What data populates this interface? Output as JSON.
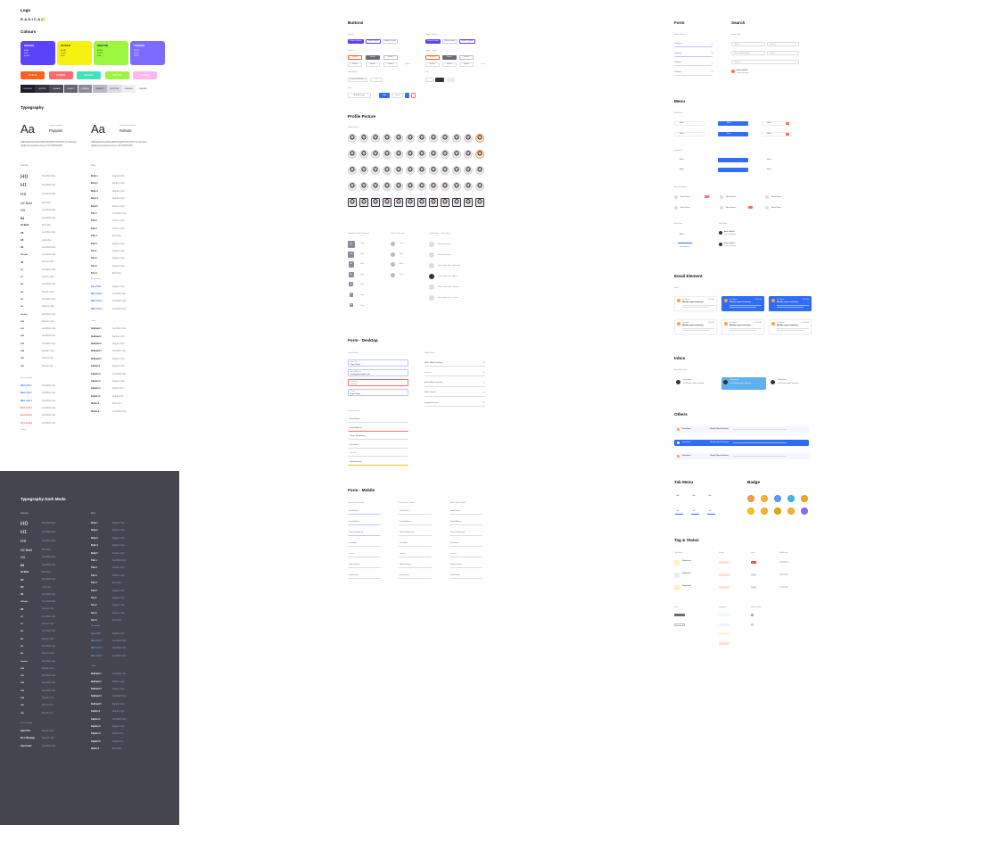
{
  "logo": {
    "heading": "Logo",
    "wordmark": "RADICAL"
  },
  "colours": {
    "heading": "Colours",
    "primary": [
      {
        "name": "#5943FE",
        "codes": [
          "R 89",
          "G 67",
          "B 254"
        ],
        "bg": "#5b43fb",
        "fg": "#ffffff"
      },
      {
        "name": "#F5F212",
        "codes": [
          "R 245",
          "G 242",
          "B 18"
        ],
        "bg": "#f5f212",
        "fg": "#1d1d2b"
      },
      {
        "name": "#9BF73D",
        "codes": [
          "R 155",
          "G 247",
          "B 61"
        ],
        "bg": "#9bf73d",
        "fg": "#1d1d2b"
      },
      {
        "name": "#7B6BFE",
        "codes": [
          "R 123",
          "G 107",
          "B 254"
        ],
        "bg": "#7b6bfe",
        "fg": "#ffffff"
      }
    ],
    "secondary": [
      {
        "name": "#FF5F1F",
        "bg": "#ff5f1f"
      },
      {
        "name": "#FF6B6B",
        "bg": "#ff6b6b"
      },
      {
        "name": "#41E2BA",
        "bg": "#41e2ba"
      },
      {
        "name": "#9BF73D",
        "bg": "#9bf73d"
      },
      {
        "name": "#FFB8EC",
        "bg": "#ffb8ec"
      }
    ],
    "greys": [
      {
        "name": "#1D1D2B",
        "bg": "#1d1d2b",
        "fg": "#ffffff"
      },
      {
        "name": "#32323F",
        "bg": "#32323f",
        "fg": "#ffffff"
      },
      {
        "name": "#4A4A58",
        "bg": "#4a4a58",
        "fg": "#ffffff"
      },
      {
        "name": "#646472",
        "bg": "#646472",
        "fg": "#ffffff"
      },
      {
        "name": "#8B8B99",
        "bg": "#8b8b99",
        "fg": "#ffffff"
      },
      {
        "name": "#B9B9C4",
        "bg": "#b9b9c4",
        "fg": "#1d1d2b"
      },
      {
        "name": "#DCDCE4",
        "bg": "#dcdce4",
        "fg": "#1d1d2b"
      },
      {
        "name": "#EFEFF4",
        "bg": "#efeff4",
        "fg": "#1d1d2b"
      },
      {
        "name": "#FFFFFF",
        "bg": "#ffffff",
        "fg": "#1d1d2b"
      }
    ]
  },
  "typography": {
    "heading": "Typography",
    "font1": {
      "sample": "Aa",
      "caption": "Primary Typeface",
      "name": "Poppins",
      "alphabet": "ABCDEFGHIJKLMNOPQRSTUVWXYZ abcdefghijklmnopqrstuvwxyz 0123456789"
    },
    "font2": {
      "sample": "Aa",
      "caption": "Secondary Typeface",
      "name": "Roboto",
      "alphabet": "ABCDEFGHIJKLMNOPQRSTUVWXYZ abcdefghijklmnopqrstuvwxyz 0123456789"
    },
    "left_col_title": "Heading",
    "right_col_title": "Body",
    "headings": [
      {
        "tag": "H0",
        "desc": "SemiBold 96px",
        "size": 6.4
      },
      {
        "tag": "H1",
        "desc": "SemiBold 64px",
        "size": 5.6
      },
      {
        "tag": "H2",
        "desc": "SemiBold 48px",
        "size": 4.8
      },
      {
        "tag": "H2 Bold",
        "desc": "Bold 48px",
        "size": 3.6
      },
      {
        "tag": "H3",
        "desc": "SemiBold 40px",
        "size": 3.8
      },
      {
        "tag": "H4",
        "desc": "SemiBold 32px",
        "size": 3.2
      },
      {
        "tag": "H4 Bold",
        "desc": "Bold 32px",
        "size": 2.4
      },
      {
        "tag": "H5",
        "desc": "SemiBold 24px",
        "size": 2.6
      },
      {
        "tag": "H5",
        "desc": "Light 24px",
        "size": 2.6
      },
      {
        "tag": "H6",
        "desc": "SemiBold 20px",
        "size": 2.4
      },
      {
        "tag": "H6 Italic",
        "desc": "SemiBold 20px",
        "size": 2.2
      },
      {
        "tag": "H6",
        "desc": "Medium 20px",
        "size": 2.4
      },
      {
        "tag": "H7",
        "desc": "SemiBold 18px",
        "size": 2.2
      },
      {
        "tag": "H7",
        "desc": "Medium 18px",
        "size": 2.2
      },
      {
        "tag": "H8",
        "desc": "SemiBold 16px",
        "size": 2.2
      },
      {
        "tag": "H8",
        "desc": "Regular 16px",
        "size": 2.2
      },
      {
        "tag": "H9",
        "desc": "SemiBold 14px",
        "size": 2.2
      },
      {
        "tag": "H9",
        "desc": "Medium 14px",
        "size": 2.2
      },
      {
        "tag": "Overline",
        "desc": "SemiBold 12px",
        "size": 2.0
      },
      {
        "tag": "H10",
        "desc": "Regular 12px",
        "size": 2.2
      },
      {
        "tag": "H11",
        "desc": "SemiBold 12px",
        "size": 2.2
      },
      {
        "tag": "H12",
        "desc": "SemiBold 10px",
        "size": 2.2
      },
      {
        "tag": "H13",
        "desc": "SemiBold 10px",
        "size": 2.2
      },
      {
        "tag": "H14",
        "desc": "Regular 10px",
        "size": 2.2
      },
      {
        "tag": "H15",
        "desc": "Medium 8px",
        "size": 2.0
      },
      {
        "tag": "H16",
        "desc": "Regular 8px",
        "size": 2.0
      }
    ],
    "bodies": [
      {
        "tag": "Body 1",
        "desc": "Regular 16px"
      },
      {
        "tag": "Body 2",
        "desc": "Medium 16px"
      },
      {
        "tag": "Body 3",
        "desc": "Regular 14px"
      },
      {
        "tag": "Body 4",
        "desc": "Regular 14px"
      },
      {
        "tag": "Body 5",
        "desc": "Medium 14px"
      },
      {
        "tag": "Title 1",
        "desc": "SemiBold 14px"
      },
      {
        "tag": "Title 2",
        "desc": "Medium 12px"
      },
      {
        "tag": "Title 3",
        "desc": "Medium 12px"
      },
      {
        "tag": "Title 4",
        "desc": "Bold 12px"
      },
      {
        "tag": "Title 5",
        "desc": "Regular 12px"
      },
      {
        "tag": "Text 1",
        "desc": "Regular 12px"
      },
      {
        "tag": "Text 2",
        "desc": "Regular 10px"
      },
      {
        "tag": "Text 3",
        "desc": "Medium 10px"
      },
      {
        "tag": "Text 4",
        "desc": "Bold 10px"
      }
    ],
    "links_title": "Text Link Style",
    "links": [
      {
        "tag": "Main Link 1",
        "desc": "SemiBold 14px",
        "color": "#2f6df6"
      },
      {
        "tag": "Main Link 2",
        "desc": "SemiBold 12px",
        "color": "#2f6df6"
      },
      {
        "tag": "Main Link 3",
        "desc": "SemiBold 10px",
        "color": "#2f6df6"
      },
      {
        "tag": "Error Link 1",
        "desc": "SemiBold 14px",
        "color": "#ff4b4b"
      },
      {
        "tag": "Error Link 2",
        "desc": "SemiBold 12px",
        "color": "#ff4b4b"
      },
      {
        "tag": "Error Link 3",
        "desc": "SemiBold 10px",
        "color": "#ff4b4b"
      }
    ],
    "labels_title": "Label",
    "labels": [
      {
        "tag": "Subhead 1",
        "desc": "SemiBold 14px"
      },
      {
        "tag": "Subhead 2",
        "desc": "Medium 14px"
      },
      {
        "tag": "Subhead 3",
        "desc": "Regular 14px"
      },
      {
        "tag": "Subhead 4",
        "desc": "SemiBold 12px"
      },
      {
        "tag": "Subhead 5",
        "desc": "Medium 12px"
      },
      {
        "tag": "Caption 1",
        "desc": "Regular 12px"
      },
      {
        "tag": "Caption 2",
        "desc": "SemiBold 10px"
      },
      {
        "tag": "Caption 3",
        "desc": "Regular 10px"
      },
      {
        "tag": "Caption 4",
        "desc": "Medium 8px"
      },
      {
        "tag": "Caption 5",
        "desc": "Regular 8px"
      },
      {
        "tag": "Button 1",
        "desc": "Bold 14px"
      },
      {
        "tag": "Button 2",
        "desc": "SemiBold 12px"
      }
    ],
    "misc_title": "Placeholder",
    "misc": [
      {
        "tag": "Input Title",
        "desc": "Regular 14px"
      },
      {
        "tag": "Main Link 1",
        "desc": "SemiBold 14px"
      },
      {
        "tag": "Main Link 2",
        "desc": "SemiBold 12px"
      },
      {
        "tag": "Main Link 3",
        "desc": "SemiBold 10px"
      }
    ],
    "other_title": "Others",
    "other": [
      {
        "tag": "Input Text",
        "desc": "Regular 14px"
      },
      {
        "tag": "Error Message",
        "desc": "Medium 10px"
      },
      {
        "tag": "Input Label",
        "desc": "SemiBold 10px"
      }
    ]
  },
  "typography_dark": {
    "heading": "Typography Dark Mode"
  },
  "buttons": {
    "heading": "Buttons",
    "group1_label": "Default",
    "group2_label": "Large - Default",
    "group3_label": "Outline",
    "group4_label": "Large - Outline",
    "group5_label": "Dark Button",
    "group6_label": "Icon",
    "small_labels": [
      "Button Default",
      "Button Hover",
      "Button Disable"
    ],
    "outline_labels": [
      "Button",
      "Button",
      "Button",
      "Button"
    ],
    "dropdown_label": "Country Selection",
    "icon_labels": [
      "Add Message",
      "Add",
      "Back"
    ]
  },
  "profile": {
    "heading": "Profile Picture",
    "subheading": "Profile Picture",
    "rows": 5,
    "cols": 12,
    "avatar_label_col1": "Standard Profile Thumbnail",
    "avatar_label_col2": "Circle Profile Icon",
    "avatar_label_col3": "Profile Name + Description",
    "square_sizes": [
      "72px",
      "56px",
      "48px",
      "40px",
      "32px",
      "24px",
      "20px"
    ],
    "circle_sizes": [
      "72px",
      "56px",
      "48px",
      "40px"
    ],
    "named": [
      "Aswin with Story",
      "Aswin with Story",
      "Name Here Here - Education",
      "Name Here Here - Admin",
      "Name Here Here - Teacher",
      "Name Here Here - Owner"
    ]
  },
  "form_desktop": {
    "heading": "Form - Desktop",
    "left_label": "Default State",
    "right_label": "Default Form",
    "fields_left": [
      {
        "label": "Input Title",
        "value": "Input Value"
      },
      {
        "label": "Email Address",
        "value": "testing@example.com"
      },
      {
        "label": "Password",
        "value": "••••••••••"
      },
      {
        "label": "Phone",
        "value": "Input Value"
      }
    ],
    "fields_right": [
      {
        "value": "Enter Rider Package"
      },
      {
        "value": "••••••••••"
      },
      {
        "value": "Enter Rider Package"
      },
      {
        "value": "Select Item 2"
      },
      {
        "value": "Upload the item"
      }
    ],
    "lower_label": "Checkbox Form",
    "lower_fields": [
      "Email Name",
      "Email Address",
      "Phone Numbering",
      "Password",
      "••••••••••",
      "Upload Image"
    ]
  },
  "form_mobile": {
    "heading": "Form - Mobile",
    "col_labels": [
      "Default State Mobile",
      "Default Form Mobile",
      "Default State Mobile"
    ]
  },
  "form": {
    "heading": "Form",
    "label": "Select Country",
    "items": [
      "Country",
      "Country",
      "Country",
      "Country"
    ]
  },
  "search": {
    "heading": "Search",
    "label": "Search Box",
    "items": [
      "Search",
      "Search Name Here",
      "Search"
    ],
    "result_name": "Aswin Bakhil",
    "result_sub": "Project Manager"
  },
  "menu": {
    "heading": "Menu",
    "label1": "Side Menu",
    "label2": "Bar Menu",
    "label3": "Menu & Options",
    "label4": "Multi Filter",
    "items": [
      "Menu",
      "Menu",
      "Menu",
      "Menu",
      "Menu",
      "Menu"
    ],
    "active": "Menu Name"
  },
  "email": {
    "heading": "Email Element",
    "label": "Email",
    "cards": [
      {
        "name": "Rina Ayuni",
        "title": "Weekly report meeting",
        "time": "09:00 AM",
        "active": false
      },
      {
        "name": "Rina Ayuni",
        "title": "Weekly report meeting",
        "time": "09:00 AM",
        "active": true
      },
      {
        "name": "Rina Ayuni",
        "title": "Weekly report meeting",
        "time": "09:00 AM",
        "active": true
      },
      {
        "name": "Rina Ayuni",
        "title": "Weekly report meeting",
        "time": "09:00 AM",
        "active": false
      },
      {
        "name": "Rina Ayuni",
        "title": "Weekly report meeting",
        "time": "09:00 AM",
        "active": false
      },
      {
        "name": "Rina Ayuni",
        "title": "Weekly report meeting",
        "time": "09:00 AM",
        "active": false
      }
    ]
  },
  "inbox": {
    "heading": "Inbox",
    "label": "Inbox Messages",
    "items": [
      {
        "name": "Rina Ayuni",
        "text": "Hi, Weekly report meeting"
      },
      {
        "name": "Rina Ayuni",
        "text": "Hi, Weekly report meeting"
      },
      {
        "name": "Rina Ayuni",
        "text": "Hi, Weekly report meeting"
      }
    ]
  },
  "others": {
    "heading": "Others",
    "rows": [
      {
        "sender": "Rina Ayuni",
        "subject": "Weekly Report Meeting",
        "active": false
      },
      {
        "sender": "Rina Ayuni",
        "subject": "Weekly Report Meeting",
        "active": true
      },
      {
        "sender": "Rina Ayuni",
        "subject": "Weekly Report Meeting",
        "active": false
      }
    ]
  },
  "tab_menu": {
    "heading": "Tab Menu",
    "tabs": [
      "Tab",
      "Tab",
      "Tab",
      "Tab",
      "Tab",
      "Tab"
    ]
  },
  "badge": {
    "heading": "Badge",
    "colors": [
      "#ff9d3d",
      "#ffb02e",
      "#5a9bff",
      "#3fb7e8",
      "#ffa21f",
      "#f5c518",
      "#f0b429",
      "#e0a800",
      "#ffb02e",
      "#8b6cff"
    ]
  },
  "tags": {
    "heading": "Tag & Status",
    "col_labels": [
      "Tag Status",
      "Status",
      "Label",
      "Notification"
    ],
    "items": [
      "Registered",
      "Registered",
      "Registered"
    ],
    "lower_labels": [
      "Tabs",
      "Progress",
      "Radio Switch"
    ]
  }
}
